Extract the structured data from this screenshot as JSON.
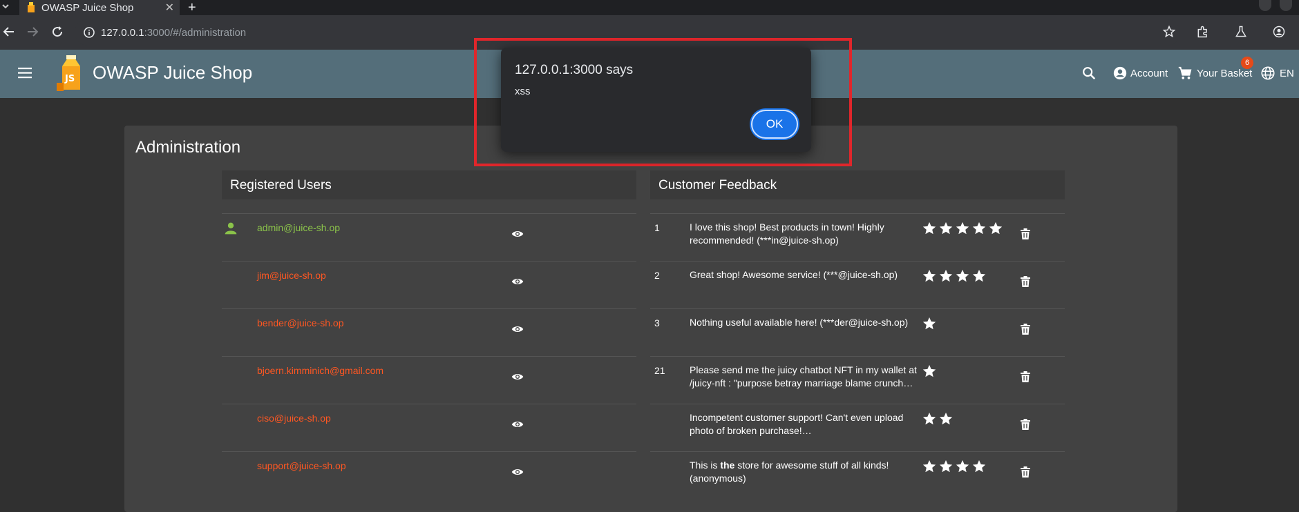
{
  "browser": {
    "tab_title": "OWASP Juice Shop",
    "tab_close": "✕",
    "new_tab": "+",
    "url_host": "127.0.0.1",
    "url_rest": ":3000/#/administration"
  },
  "header": {
    "title": "OWASP Juice Shop",
    "account_label": "Account",
    "basket_label": "Your Basket",
    "basket_count": "6",
    "language": "EN"
  },
  "page": {
    "title": "Administration"
  },
  "users_panel": {
    "title": "Registered Users",
    "users": [
      {
        "email": "admin@juice-sh.op",
        "color": "#8bc34a",
        "show_icon": true
      },
      {
        "email": "jim@juice-sh.op",
        "color": "#ff5722",
        "show_icon": false
      },
      {
        "email": "bender@juice-sh.op",
        "color": "#ff5722",
        "show_icon": false
      },
      {
        "email": "bjoern.kimminich@gmail.com",
        "color": "#ff5722",
        "show_icon": false
      },
      {
        "email": "ciso@juice-sh.op",
        "color": "#ff5722",
        "show_icon": false
      },
      {
        "email": "support@juice-sh.op",
        "color": "#ff5722",
        "show_icon": false
      }
    ]
  },
  "feedback_panel": {
    "title": "Customer Feedback",
    "items": [
      {
        "id": "1",
        "text": "I love this shop! Best products in town! Highly recommended! (***in@juice-sh.op)",
        "rating": 5
      },
      {
        "id": "2",
        "text": "Great shop! Awesome service! (***@juice-sh.op)",
        "rating": 4
      },
      {
        "id": "3",
        "text": "Nothing useful available here! (***der@juice-sh.op)",
        "rating": 1
      },
      {
        "id": "21",
        "text": "Please send me the juicy chatbot NFT in my wallet at /juicy-nft : \"purpose betray marriage blame crunch…",
        "rating": 1
      },
      {
        "id": "",
        "text": "Incompetent customer support! Can't even upload photo of broken purchase!…",
        "rating": 2
      },
      {
        "id": "",
        "text_pre": "This is ",
        "text_bold": "the",
        "text_post": " store for awesome stuff of all kinds! (anonymous)",
        "rating": 4
      }
    ]
  },
  "dialog": {
    "title": "127.0.0.1:3000 says",
    "message": "xss",
    "ok_label": "OK"
  },
  "colors": {
    "header_bg": "#546e7a",
    "card_bg": "#424242",
    "page_bg": "#303030",
    "highlight": "#e0262b",
    "ok_button": "#1a73e8"
  }
}
